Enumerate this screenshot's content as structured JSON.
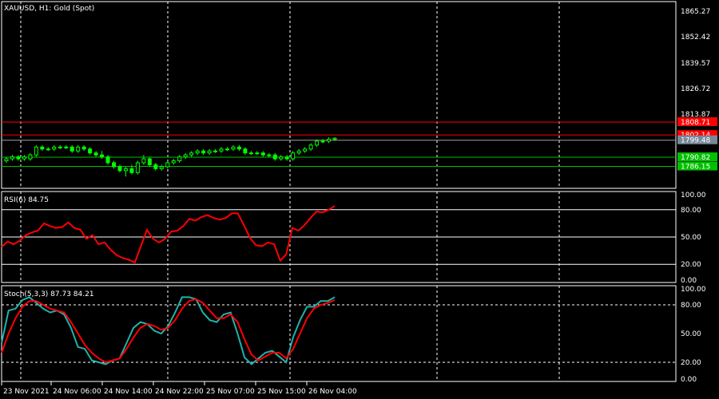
{
  "colors": {
    "background": "#000000",
    "grid": "#ffffff",
    "bull": "#00ff00",
    "bear": "#00ff00",
    "rsi_line": "#ff0000",
    "stoch_main": "#20b2aa",
    "stoch_signal": "#ff0000",
    "level_red": "#ff0000",
    "level_green": "#00c000",
    "current_price_tag": "#778899"
  },
  "chart_data": [
    {
      "type": "candlestick",
      "title": "XAUUSD, H1:  Gold (Spot)",
      "ylim": [
        1775,
        1870
      ],
      "y_ticks": [
        "1865.27",
        "1852.42",
        "1839.57",
        "1826.72",
        "1813.87"
      ],
      "x_tick_labels": [
        "23 Nov 2021",
        "24 Nov 06:00",
        "24 Nov 14:00",
        "24 Nov 22:00",
        "25 Nov 07:00",
        "25 Nov 15:00",
        "26 Nov 04:00"
      ],
      "price_levels": [
        {
          "label": "1808.71",
          "value": 1808.71,
          "color": "red"
        },
        {
          "label": "1802.14",
          "value": 1802.14,
          "color": "red"
        },
        {
          "label": "1799.48",
          "value": 1799.48,
          "color": "gray"
        },
        {
          "label": "1790.82",
          "value": 1790.82,
          "color": "green"
        },
        {
          "label": "1786.15",
          "value": 1786.15,
          "color": "green"
        }
      ],
      "candles": [
        [
          1789,
          1791,
          1788,
          1790
        ],
        [
          1790,
          1792,
          1789,
          1791
        ],
        [
          1791,
          1792,
          1789,
          1790
        ],
        [
          1790,
          1792,
          1789,
          1791
        ],
        [
          1790,
          1793,
          1789,
          1792
        ],
        [
          1792,
          1797,
          1791,
          1796
        ],
        [
          1796,
          1797,
          1794,
          1795
        ],
        [
          1795,
          1796,
          1794,
          1795
        ],
        [
          1795,
          1797,
          1794,
          1796
        ],
        [
          1796,
          1797,
          1795,
          1796
        ],
        [
          1796,
          1797,
          1795,
          1796
        ],
        [
          1796,
          1797,
          1793,
          1794
        ],
        [
          1794,
          1797,
          1793,
          1796
        ],
        [
          1796,
          1797,
          1794,
          1795
        ],
        [
          1795,
          1796,
          1792,
          1793
        ],
        [
          1793,
          1794,
          1791,
          1792
        ],
        [
          1792,
          1794,
          1790,
          1791
        ],
        [
          1791,
          1792,
          1787,
          1788
        ],
        [
          1788,
          1789,
          1785,
          1786
        ],
        [
          1786,
          1787,
          1783,
          1784
        ],
        [
          1784,
          1786,
          1781,
          1785
        ],
        [
          1785,
          1787,
          1782,
          1783
        ],
        [
          1783,
          1789,
          1782,
          1788
        ],
        [
          1788,
          1792,
          1787,
          1790
        ],
        [
          1790,
          1791,
          1786,
          1787
        ],
        [
          1787,
          1788,
          1784,
          1785
        ],
        [
          1785,
          1787,
          1784,
          1786
        ],
        [
          1786,
          1789,
          1785,
          1788
        ],
        [
          1788,
          1790,
          1787,
          1789
        ],
        [
          1789,
          1792,
          1788,
          1791
        ],
        [
          1791,
          1793,
          1790,
          1792
        ],
        [
          1792,
          1794,
          1791,
          1793
        ],
        [
          1793,
          1795,
          1792,
          1794
        ],
        [
          1794,
          1795,
          1792,
          1793
        ],
        [
          1793,
          1795,
          1792,
          1794
        ],
        [
          1794,
          1795,
          1793,
          1794
        ],
        [
          1794,
          1796,
          1793,
          1795
        ],
        [
          1795,
          1796,
          1794,
          1795
        ],
        [
          1795,
          1797,
          1794,
          1796
        ],
        [
          1796,
          1797,
          1794,
          1795
        ],
        [
          1795,
          1796,
          1792,
          1793
        ],
        [
          1793,
          1794,
          1792,
          1793
        ],
        [
          1793,
          1794,
          1792,
          1793
        ],
        [
          1793,
          1794,
          1791,
          1792
        ],
        [
          1792,
          1793,
          1791,
          1792
        ],
        [
          1792,
          1793,
          1789,
          1790
        ],
        [
          1790,
          1792,
          1789,
          1791
        ],
        [
          1791,
          1792,
          1789,
          1790
        ],
        [
          1790,
          1794,
          1789,
          1793
        ],
        [
          1793,
          1795,
          1792,
          1794
        ],
        [
          1794,
          1796,
          1793,
          1795
        ],
        [
          1795,
          1798,
          1794,
          1797
        ],
        [
          1797,
          1800,
          1796,
          1799
        ],
        [
          1799,
          1800,
          1798,
          1799
        ],
        [
          1799,
          1801,
          1798,
          1800
        ],
        [
          1800,
          1801,
          1799,
          1800.5
        ]
      ]
    },
    {
      "type": "line",
      "title": "RSI(6) 84.75",
      "ylim": [
        0,
        100
      ],
      "y_ticks": [
        "100.00",
        "80.00",
        "50.00",
        "20.00",
        "0.00"
      ],
      "levels": [
        80,
        50,
        20
      ],
      "series": [
        {
          "name": "RSI(6)",
          "values": [
            39,
            45,
            42,
            46,
            52,
            55,
            57,
            65,
            62,
            60,
            61,
            66,
            60,
            58,
            48,
            52,
            42,
            44,
            36,
            30,
            27,
            25,
            22,
            40,
            58,
            48,
            44,
            48,
            56,
            57,
            62,
            70,
            68,
            72,
            74,
            71,
            69,
            71,
            76,
            76,
            63,
            49,
            41,
            40,
            44,
            42,
            24,
            31,
            60,
            57,
            63,
            71,
            78,
            77,
            80,
            84
          ]
        }
      ]
    },
    {
      "type": "line",
      "title": "Stoch(5,3,3) 87.73 84.21",
      "ylim": [
        0,
        100
      ],
      "y_ticks": [
        "100.00",
        "80.00",
        "50.00",
        "20.00",
        "0.00"
      ],
      "levels": [
        80,
        20
      ],
      "series": [
        {
          "name": "Main",
          "values": [
            40,
            74,
            76,
            85,
            88,
            82,
            76,
            72,
            74,
            70,
            56,
            36,
            34,
            22,
            20,
            18,
            22,
            24,
            40,
            56,
            62,
            60,
            53,
            50,
            58,
            72,
            88,
            88,
            86,
            72,
            64,
            62,
            70,
            72,
            50,
            25,
            18,
            24,
            30,
            32,
            26,
            20,
            46,
            64,
            78,
            78,
            84,
            84,
            88
          ]
        },
        {
          "name": "Signal",
          "values": [
            30,
            50,
            66,
            78,
            84,
            84,
            80,
            76,
            74,
            72,
            62,
            50,
            38,
            30,
            24,
            20,
            22,
            24,
            34,
            46,
            56,
            60,
            58,
            54,
            56,
            64,
            76,
            84,
            86,
            82,
            74,
            66,
            66,
            70,
            62,
            44,
            28,
            22,
            26,
            30,
            30,
            24,
            34,
            50,
            66,
            76,
            80,
            82,
            85
          ]
        }
      ]
    }
  ],
  "price_axis": {
    "tick_labels": [
      "1865.27",
      "1852.42",
      "1839.57",
      "1826.72",
      "1813.87"
    ]
  },
  "time_axis": {
    "labels": [
      "23 Nov 2021",
      "24 Nov 06:00",
      "24 Nov 14:00",
      "24 Nov 22:00",
      "25 Nov 07:00",
      "25 Nov 15:00",
      "26 Nov 04:00"
    ]
  }
}
